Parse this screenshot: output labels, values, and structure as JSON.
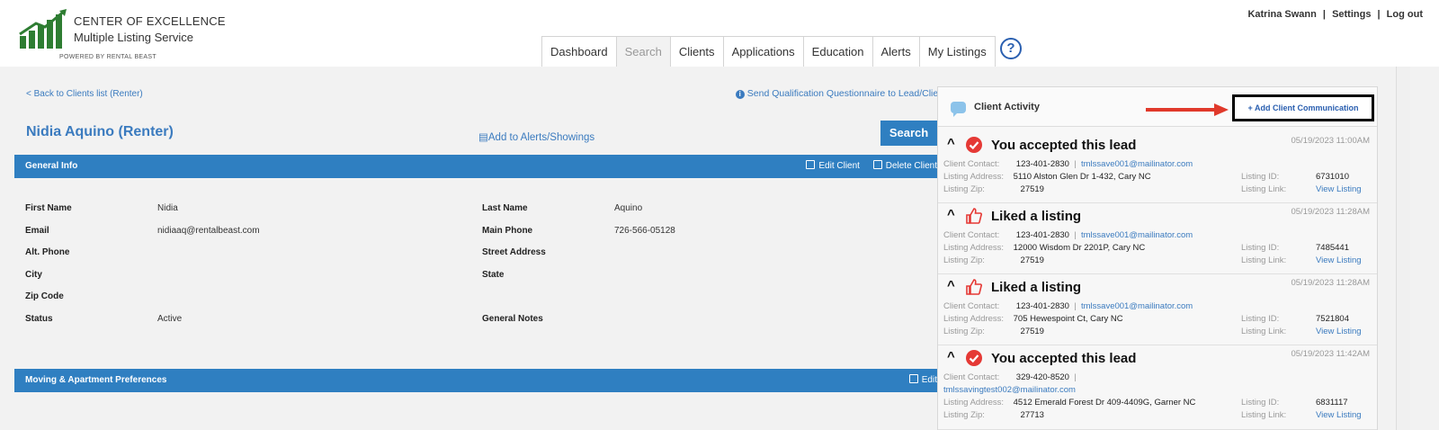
{
  "logo": {
    "line1": "CENTER OF EXCELLENCE",
    "line2": "Multiple Listing Service",
    "line3": "POWERED BY RENTAL BEAST"
  },
  "user": {
    "name": "Katrina Swann",
    "settings": "Settings",
    "logout": "Log out",
    "sep": "|"
  },
  "nav": {
    "tabs": [
      "Dashboard",
      "Search",
      "Clients",
      "Applications",
      "Education",
      "Alerts",
      "My Listings"
    ],
    "active": "Search",
    "help": "?"
  },
  "page": {
    "back": "< Back to Clients list (Renter)",
    "send_questionnaire": "Send Qualification Questionnaire to Lead/Client",
    "client_name": "Nidia Aquino (Renter)",
    "add_alerts": "Add to Alerts/Showings",
    "search_btn": "Search"
  },
  "general": {
    "title": "General Info",
    "edit": "Edit Client",
    "delete": "Delete Client",
    "fields": {
      "first_name_label": "First Name",
      "first_name": "Nidia",
      "last_name_label": "Last Name",
      "last_name": "Aquino",
      "email_label": "Email",
      "email": "nidiaaq@rentalbeast.com",
      "main_phone_label": "Main Phone",
      "main_phone": "726-566-05128",
      "alt_phone_label": "Alt. Phone",
      "street_label": "Street Address",
      "city_label": "City",
      "state_label": "State",
      "zip_label": "Zip Code",
      "status_label": "Status",
      "status": "Active",
      "notes_label": "General Notes"
    }
  },
  "moving": {
    "title": "Moving & Apartment Preferences",
    "edit": "Edit"
  },
  "activity": {
    "title": "Client Activity",
    "add": "+ Add Client Communication",
    "labels": {
      "contact": "Client Contact:",
      "address": "Listing Address:",
      "zip": "Listing Zip:",
      "id": "Listing ID:",
      "link": "Listing Link:",
      "view": "View Listing",
      "pipe": "|"
    },
    "items": [
      {
        "title": "You accepted this lead",
        "date": "05/19/2023 11:00AM",
        "phone": "123-401-2830",
        "email": "tmlssave001@mailinator.com",
        "address": "5110 Alston Glen Dr 1-432, Cary NC",
        "zip": "27519",
        "listing_id": "6731010"
      },
      {
        "title": "Liked a listing",
        "date": "05/19/2023 11:28AM",
        "phone": "123-401-2830",
        "email": "tmlssave001@mailinator.com",
        "address": "12000 Wisdom Dr 2201P, Cary NC",
        "zip": "27519",
        "listing_id": "7485441"
      },
      {
        "title": "Liked a listing",
        "date": "05/19/2023 11:28AM",
        "phone": "123-401-2830",
        "email": "tmlssave001@mailinator.com",
        "address": "705 Hewespoint Ct, Cary NC",
        "zip": "27519",
        "listing_id": "7521804"
      },
      {
        "title": "You accepted this lead",
        "date": "05/19/2023 11:42AM",
        "phone": "329-420-8520",
        "email": "tmlssavingtest002@mailinator.com",
        "address": "4512 Emerald Forest Dr 409-4409G, Garner NC",
        "zip": "27713",
        "listing_id": "6831117"
      }
    ]
  },
  "colors": {
    "brand_blue": "#2f7fc1",
    "link_blue": "#3b7bbf",
    "logo_green": "#2e7d32",
    "check_red": "#e53935",
    "arrow_red": "#e0392b"
  },
  "icons": [
    "bar-chart-logo-icon",
    "help-icon",
    "info-icon",
    "list-icon",
    "edit-icon",
    "trash-icon",
    "chat-bubble-icon",
    "chevron-up-icon",
    "check-circle-icon",
    "thumbs-up-icon",
    "arrow-right-icon"
  ]
}
